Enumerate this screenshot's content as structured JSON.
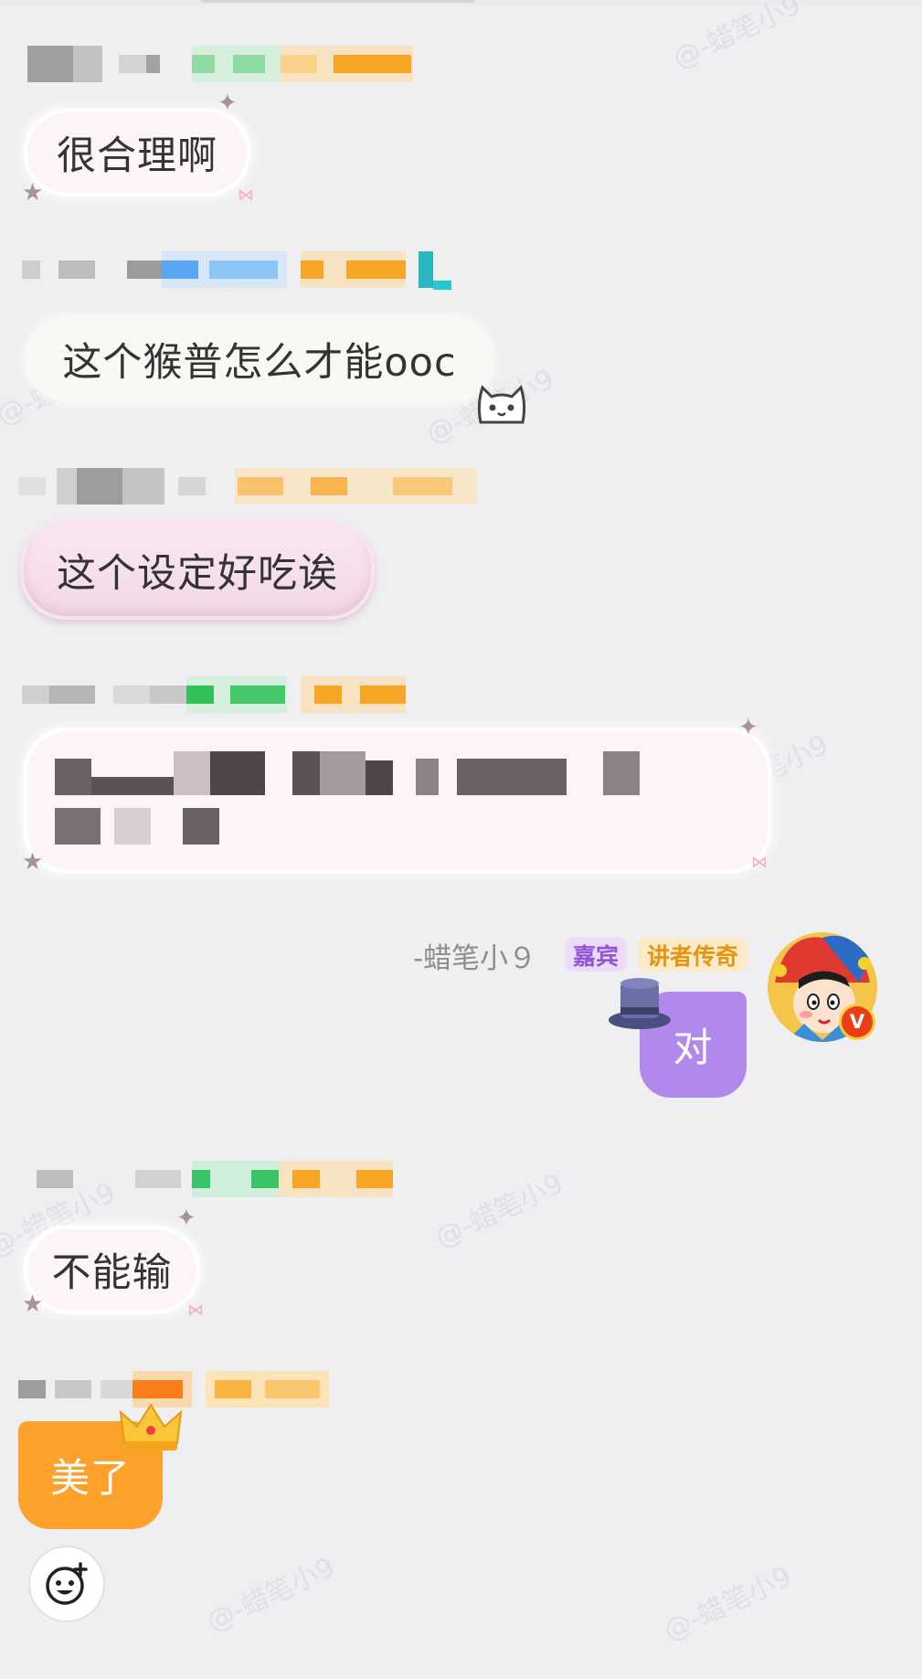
{
  "watermark": "@-蜡笔小9",
  "messages": [
    {
      "text": "很合理啊",
      "style": "star-bubble"
    },
    {
      "text": "这个猴普怎么才能ooc",
      "style": "white-cat-bubble"
    },
    {
      "text": "这个设定好吃诶",
      "style": "pink-jelly-bubble"
    },
    {
      "text": "",
      "style": "star-bubble-wide-blurred"
    },
    {
      "text": "不能输",
      "style": "star-bubble"
    },
    {
      "text": "美了",
      "style": "orange-crown-bubble"
    }
  ],
  "self_message": {
    "username": "-蜡笔小９",
    "tag_guest": "嘉宾",
    "tag_legend": "讲者传奇",
    "text": "对",
    "avatar_badge": "V",
    "bubble_color": "#b188ec"
  },
  "emoji_button_icon": "emoji-add-icon"
}
